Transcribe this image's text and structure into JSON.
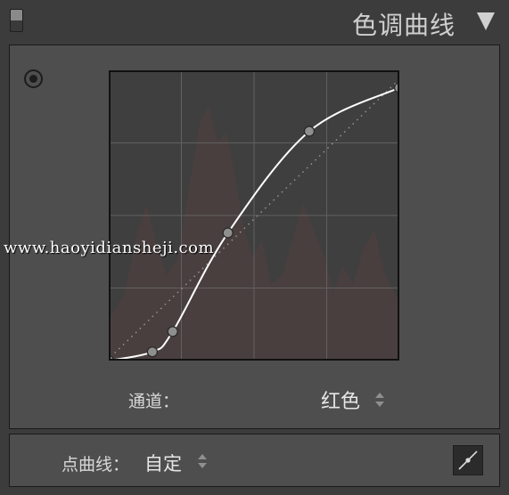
{
  "header": {
    "title": "色调曲线"
  },
  "watermark": "www.haoyidiansheji.com",
  "channel": {
    "label": "通道：",
    "value": "红色"
  },
  "point_curve": {
    "label": "点曲线：",
    "value": "自定"
  },
  "curve": {
    "points": [
      [
        0,
        0
      ],
      [
        0.15,
        0.03
      ],
      [
        0.22,
        0.1
      ],
      [
        0.41,
        0.44
      ],
      [
        0.69,
        0.79
      ],
      [
        1,
        0.94
      ]
    ],
    "histogram_color": "#54403f",
    "curve_color": "#ffffff",
    "point_fill": "#8f8f8f"
  },
  "colors": {
    "background": "#3c3c3c",
    "panel": "#4e4e4e",
    "curve_area": "#3f3f3f",
    "text": "#d8d8d8"
  },
  "icons": {
    "panel_toggle": "panel-toggle-icon",
    "collapse": "collapse-triangle-icon",
    "targeted_adjustment": "targeted-adjustment-icon",
    "point_curve_edit": "edit-point-curve-icon"
  }
}
